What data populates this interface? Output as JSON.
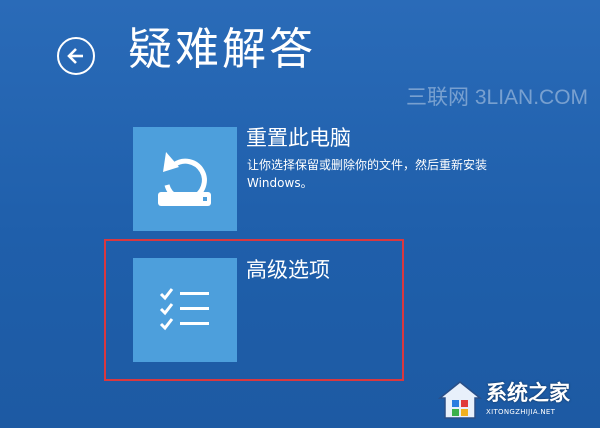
{
  "header": {
    "title": "疑难解答",
    "back_icon": "back-arrow-icon"
  },
  "options": [
    {
      "title": "重置此电脑",
      "description": "让你选择保留或删除你的文件，然后重新安装 Windows。",
      "icon": "reset-pc-icon"
    },
    {
      "title": "高级选项",
      "icon": "checklist-icon"
    }
  ],
  "watermarks": {
    "top": "三联网 3LIAN.COM",
    "logo_text": "系统之家",
    "logo_url": "XITONGZHIJIA.NET"
  },
  "colors": {
    "background": "#1f5ea8",
    "tile": "#4d9fdc",
    "highlight": "#d9383f"
  }
}
